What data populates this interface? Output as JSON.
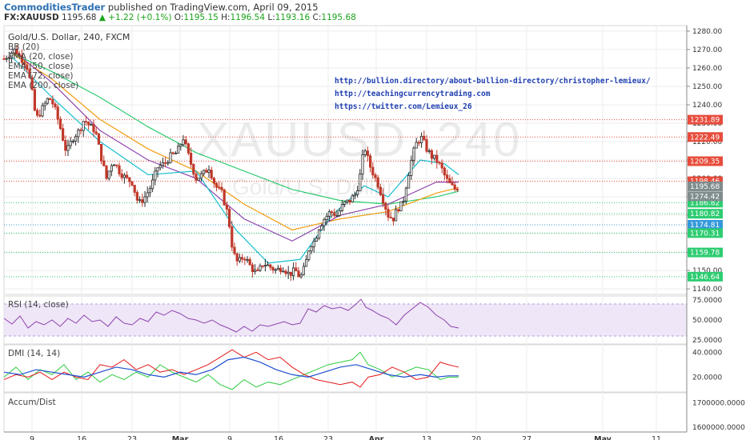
{
  "header": {
    "author": "CommoditiesTrader",
    "published_text": "published on TradingView.com, April 09, 2015",
    "symbol": "FX:XAUUSD",
    "last": "1195.68",
    "change": "+1.22 (+0.1%)",
    "open_label": "O:",
    "open": "1195.15",
    "high_label": "H:",
    "high": "1196.54",
    "low_label": "L:",
    "low": "1193.16",
    "close_label": "C:",
    "close": "1195.68"
  },
  "main_pane": {
    "title": "Gold/U.S. Dollar, 240, FXCM",
    "indicators": [
      "BB (20)",
      "EMA (20, close)",
      "EMA (50, close)",
      "EMA (72, close)",
      "EMA (200, close)"
    ],
    "watermark_symbol": "XAUUSD, 240",
    "watermark_name": "Gold/U.S. Dollar",
    "links": [
      "http://bullion.directory/about-bullion-directory/christopher-lemieux/",
      "http://teachingcurrencytrading.com",
      "https://twitter.com/Lemieux_26"
    ]
  },
  "rsi_pane": {
    "label": "RSI (14, close)"
  },
  "dmi_pane": {
    "label": "DMI (14, 14)"
  },
  "accum_pane": {
    "label": "Accum/Dist"
  },
  "colors": {
    "bull": "#2a2a2a",
    "bear": "#c0392b",
    "ema20": "#17becf",
    "ema50": "#8e44ad",
    "ema72": "#f39c12",
    "ema200": "#2ecc71",
    "level_red": "#e74c3c",
    "level_green": "#2ecc71",
    "level_blue": "#3498db",
    "rsi_line": "#8e44ad",
    "rsi_band": "#efe6f7",
    "dmi_plus": "#2ecc40",
    "dmi_minus": "#e41a1c",
    "adx": "#1f4fd1"
  },
  "chart_data": {
    "type": "candlestick",
    "x_ticks": [
      "9",
      "16",
      "23",
      "Mar",
      "9",
      "16",
      "23",
      "Apr",
      "13",
      "20",
      "27",
      "May",
      "11"
    ],
    "y_ticks": [
      1140,
      1150,
      1160,
      1170,
      1180,
      1190,
      1200,
      1210,
      1220,
      1230,
      1240,
      1250,
      1260,
      1270,
      1280
    ],
    "y_tick_labels": [
      "1140.00",
      "1150.00",
      "1160.00",
      "1170.00",
      "1180.00",
      "1190.00",
      "1200.00",
      "1210.00",
      "1220.00",
      "1230.00",
      "1240.00",
      "1250.00",
      "1260.00",
      "1270.00",
      "1280.00"
    ],
    "ylim": [
      1137,
      1283
    ],
    "levels": [
      {
        "value": 1231.89,
        "label": "1231.89",
        "kind": "red"
      },
      {
        "value": 1222.49,
        "label": "1222.49",
        "kind": "red"
      },
      {
        "value": 1209.35,
        "label": "1209.35",
        "kind": "red"
      },
      {
        "value": 1198.46,
        "label": "1198.46",
        "kind": "red"
      },
      {
        "value": 1195.68,
        "label": "1195.68",
        "kind": "gray"
      },
      {
        "value": 1186.82,
        "label": "1186.82",
        "kind": "green"
      },
      {
        "value": 1180.82,
        "label": "1180.82",
        "kind": "green"
      },
      {
        "value": 1174.81,
        "label": "1174.81",
        "kind": "blue"
      },
      {
        "value": 1170.31,
        "label": "1170.31",
        "kind": "green"
      },
      {
        "value": 1159.78,
        "label": "1159.78",
        "kind": "green"
      },
      {
        "value": 1146.64,
        "label": "1146.64",
        "kind": "green"
      }
    ],
    "extra_label": "1274.42",
    "price_path": [
      [
        0,
        1265
      ],
      [
        8,
        1268
      ],
      [
        14,
        1270
      ],
      [
        20,
        1266
      ],
      [
        28,
        1262
      ],
      [
        34,
        1250
      ],
      [
        40,
        1232
      ],
      [
        48,
        1238
      ],
      [
        56,
        1244
      ],
      [
        62,
        1240
      ],
      [
        70,
        1228
      ],
      [
        78,
        1214
      ],
      [
        86,
        1222
      ],
      [
        94,
        1226
      ],
      [
        100,
        1232
      ],
      [
        108,
        1228
      ],
      [
        114,
        1226
      ],
      [
        120,
        1214
      ],
      [
        128,
        1200
      ],
      [
        136,
        1210
      ],
      [
        144,
        1204
      ],
      [
        152,
        1200
      ],
      [
        160,
        1198
      ],
      [
        168,
        1186
      ],
      [
        176,
        1190
      ],
      [
        184,
        1196
      ],
      [
        192,
        1206
      ],
      [
        200,
        1208
      ],
      [
        208,
        1212
      ],
      [
        216,
        1214
      ],
      [
        224,
        1222
      ],
      [
        232,
        1210
      ],
      [
        240,
        1200
      ],
      [
        248,
        1202
      ],
      [
        256,
        1206
      ],
      [
        264,
        1196
      ],
      [
        272,
        1192
      ],
      [
        280,
        1180
      ],
      [
        286,
        1160
      ],
      [
        292,
        1154
      ],
      [
        300,
        1158
      ],
      [
        308,
        1152
      ],
      [
        316,
        1148
      ],
      [
        324,
        1154
      ],
      [
        332,
        1152
      ],
      [
        340,
        1150
      ],
      [
        348,
        1152
      ],
      [
        356,
        1148
      ],
      [
        364,
        1150
      ],
      [
        370,
        1146
      ],
      [
        376,
        1152
      ],
      [
        382,
        1164
      ],
      [
        388,
        1166
      ],
      [
        394,
        1174
      ],
      [
        400,
        1178
      ],
      [
        408,
        1182
      ],
      [
        416,
        1180
      ],
      [
        424,
        1186
      ],
      [
        432,
        1188
      ],
      [
        440,
        1192
      ],
      [
        446,
        1204
      ],
      [
        450,
        1218
      ],
      [
        456,
        1208
      ],
      [
        462,
        1202
      ],
      [
        468,
        1196
      ],
      [
        474,
        1188
      ],
      [
        480,
        1180
      ],
      [
        486,
        1178
      ],
      [
        492,
        1184
      ],
      [
        498,
        1186
      ],
      [
        504,
        1200
      ],
      [
        510,
        1212
      ],
      [
        516,
        1220
      ],
      [
        522,
        1222
      ],
      [
        528,
        1216
      ],
      [
        534,
        1212
      ],
      [
        540,
        1210
      ],
      [
        546,
        1206
      ],
      [
        552,
        1200
      ],
      [
        558,
        1196
      ],
      [
        564,
        1194
      ],
      [
        568,
        1195.68
      ]
    ],
    "ema_paths": {
      "ema200": [
        [
          10,
          1268
        ],
        [
          60,
          1258
        ],
        [
          120,
          1244
        ],
        [
          180,
          1228
        ],
        [
          240,
          1214
        ],
        [
          300,
          1204
        ],
        [
          360,
          1194
        ],
        [
          420,
          1188
        ],
        [
          480,
          1186
        ],
        [
          540,
          1190
        ],
        [
          568,
          1193
        ]
      ],
      "ema72": [
        [
          10,
          1268
        ],
        [
          60,
          1254
        ],
        [
          120,
          1232
        ],
        [
          180,
          1216
        ],
        [
          240,
          1204
        ],
        [
          300,
          1186
        ],
        [
          360,
          1172
        ],
        [
          420,
          1178
        ],
        [
          480,
          1182
        ],
        [
          540,
          1192
        ],
        [
          568,
          1195
        ]
      ],
      "ema50": [
        [
          10,
          1270
        ],
        [
          60,
          1252
        ],
        [
          120,
          1226
        ],
        [
          180,
          1210
        ],
        [
          240,
          1200
        ],
        [
          300,
          1178
        ],
        [
          360,
          1166
        ],
        [
          420,
          1180
        ],
        [
          480,
          1186
        ],
        [
          540,
          1198
        ],
        [
          568,
          1198
        ]
      ],
      "ema20": [
        [
          10,
          1266
        ],
        [
          60,
          1244
        ],
        [
          120,
          1220
        ],
        [
          180,
          1202
        ],
        [
          240,
          1204
        ],
        [
          290,
          1172
        ],
        [
          330,
          1154
        ],
        [
          370,
          1156
        ],
        [
          410,
          1180
        ],
        [
          450,
          1196
        ],
        [
          480,
          1190
        ],
        [
          520,
          1210
        ],
        [
          550,
          1208
        ],
        [
          568,
          1202
        ]
      ]
    },
    "rsi": {
      "y_tick_labels": [
        "75.0000",
        "50.0000",
        "25.0000"
      ],
      "y_ticks": [
        75,
        50,
        25
      ],
      "ylim": [
        20,
        80
      ],
      "band": [
        30,
        70
      ],
      "values": [
        [
          0,
          52
        ],
        [
          10,
          45
        ],
        [
          20,
          55
        ],
        [
          30,
          40
        ],
        [
          40,
          48
        ],
        [
          50,
          44
        ],
        [
          60,
          50
        ],
        [
          70,
          42
        ],
        [
          80,
          52
        ],
        [
          90,
          46
        ],
        [
          100,
          56
        ],
        [
          110,
          48
        ],
        [
          120,
          50
        ],
        [
          130,
          42
        ],
        [
          140,
          54
        ],
        [
          150,
          46
        ],
        [
          160,
          44
        ],
        [
          170,
          52
        ],
        [
          180,
          48
        ],
        [
          190,
          60
        ],
        [
          200,
          56
        ],
        [
          210,
          62
        ],
        [
          220,
          58
        ],
        [
          230,
          52
        ],
        [
          240,
          50
        ],
        [
          250,
          46
        ],
        [
          260,
          50
        ],
        [
          270,
          44
        ],
        [
          280,
          40
        ],
        [
          290,
          35
        ],
        [
          300,
          42
        ],
        [
          310,
          36
        ],
        [
          320,
          44
        ],
        [
          330,
          42
        ],
        [
          340,
          45
        ],
        [
          350,
          48
        ],
        [
          360,
          44
        ],
        [
          370,
          46
        ],
        [
          380,
          64
        ],
        [
          390,
          60
        ],
        [
          400,
          68
        ],
        [
          410,
          64
        ],
        [
          420,
          66
        ],
        [
          430,
          62
        ],
        [
          440,
          70
        ],
        [
          446,
          76
        ],
        [
          452,
          66
        ],
        [
          460,
          62
        ],
        [
          470,
          56
        ],
        [
          480,
          52
        ],
        [
          490,
          44
        ],
        [
          500,
          56
        ],
        [
          510,
          64
        ],
        [
          520,
          72
        ],
        [
          530,
          66
        ],
        [
          540,
          56
        ],
        [
          550,
          50
        ],
        [
          558,
          42
        ],
        [
          568,
          40
        ]
      ]
    },
    "dmi": {
      "y_tick_labels": [
        "40.0000",
        "20.0000"
      ],
      "y_ticks": [
        40,
        20
      ],
      "ylim": [
        8,
        46
      ],
      "plus_di": [
        [
          0,
          20
        ],
        [
          15,
          28
        ],
        [
          30,
          18
        ],
        [
          45,
          26
        ],
        [
          60,
          22
        ],
        [
          75,
          30
        ],
        [
          90,
          18
        ],
        [
          105,
          24
        ],
        [
          120,
          16
        ],
        [
          135,
          22
        ],
        [
          150,
          18
        ],
        [
          165,
          24
        ],
        [
          180,
          20
        ],
        [
          195,
          30
        ],
        [
          210,
          24
        ],
        [
          225,
          20
        ],
        [
          240,
          16
        ],
        [
          255,
          22
        ],
        [
          270,
          14
        ],
        [
          285,
          10
        ],
        [
          300,
          18
        ],
        [
          315,
          12
        ],
        [
          330,
          16
        ],
        [
          345,
          14
        ],
        [
          360,
          18
        ],
        [
          375,
          22
        ],
        [
          390,
          26
        ],
        [
          405,
          30
        ],
        [
          420,
          32
        ],
        [
          435,
          34
        ],
        [
          445,
          40
        ],
        [
          455,
          30
        ],
        [
          470,
          26
        ],
        [
          485,
          20
        ],
        [
          500,
          24
        ],
        [
          515,
          28
        ],
        [
          530,
          26
        ],
        [
          545,
          18
        ],
        [
          555,
          20
        ],
        [
          568,
          20
        ]
      ],
      "minus_di": [
        [
          0,
          18
        ],
        [
          15,
          22
        ],
        [
          30,
          20
        ],
        [
          45,
          24
        ],
        [
          60,
          18
        ],
        [
          75,
          24
        ],
        [
          90,
          20
        ],
        [
          105,
          18
        ],
        [
          120,
          30
        ],
        [
          135,
          28
        ],
        [
          150,
          34
        ],
        [
          165,
          26
        ],
        [
          180,
          30
        ],
        [
          195,
          24
        ],
        [
          210,
          26
        ],
        [
          225,
          22
        ],
        [
          240,
          26
        ],
        [
          255,
          30
        ],
        [
          270,
          36
        ],
        [
          285,
          42
        ],
        [
          300,
          36
        ],
        [
          315,
          40
        ],
        [
          330,
          34
        ],
        [
          345,
          36
        ],
        [
          360,
          28
        ],
        [
          375,
          22
        ],
        [
          390,
          18
        ],
        [
          405,
          16
        ],
        [
          420,
          14
        ],
        [
          435,
          16
        ],
        [
          445,
          12
        ],
        [
          455,
          20
        ],
        [
          470,
          22
        ],
        [
          485,
          28
        ],
        [
          500,
          24
        ],
        [
          515,
          18
        ],
        [
          530,
          20
        ],
        [
          545,
          32
        ],
        [
          555,
          30
        ],
        [
          568,
          28
        ]
      ],
      "adx": [
        [
          0,
          24
        ],
        [
          20,
          22
        ],
        [
          40,
          26
        ],
        [
          60,
          24
        ],
        [
          80,
          22
        ],
        [
          100,
          20
        ],
        [
          120,
          24
        ],
        [
          140,
          28
        ],
        [
          160,
          26
        ],
        [
          180,
          22
        ],
        [
          200,
          20
        ],
        [
          220,
          24
        ],
        [
          240,
          22
        ],
        [
          260,
          26
        ],
        [
          280,
          34
        ],
        [
          300,
          36
        ],
        [
          320,
          32
        ],
        [
          340,
          26
        ],
        [
          360,
          22
        ],
        [
          380,
          20
        ],
        [
          400,
          24
        ],
        [
          420,
          28
        ],
        [
          440,
          30
        ],
        [
          460,
          26
        ],
        [
          480,
          22
        ],
        [
          500,
          20
        ],
        [
          520,
          22
        ],
        [
          540,
          20
        ],
        [
          555,
          21
        ],
        [
          568,
          21
        ]
      ]
    },
    "accum": {
      "y_tick_labels": [
        "1700000.0000",
        "1600000.0000"
      ],
      "y_ticks": [
        1700000,
        1600000
      ],
      "ylim": [
        1580000,
        1740000
      ]
    }
  }
}
